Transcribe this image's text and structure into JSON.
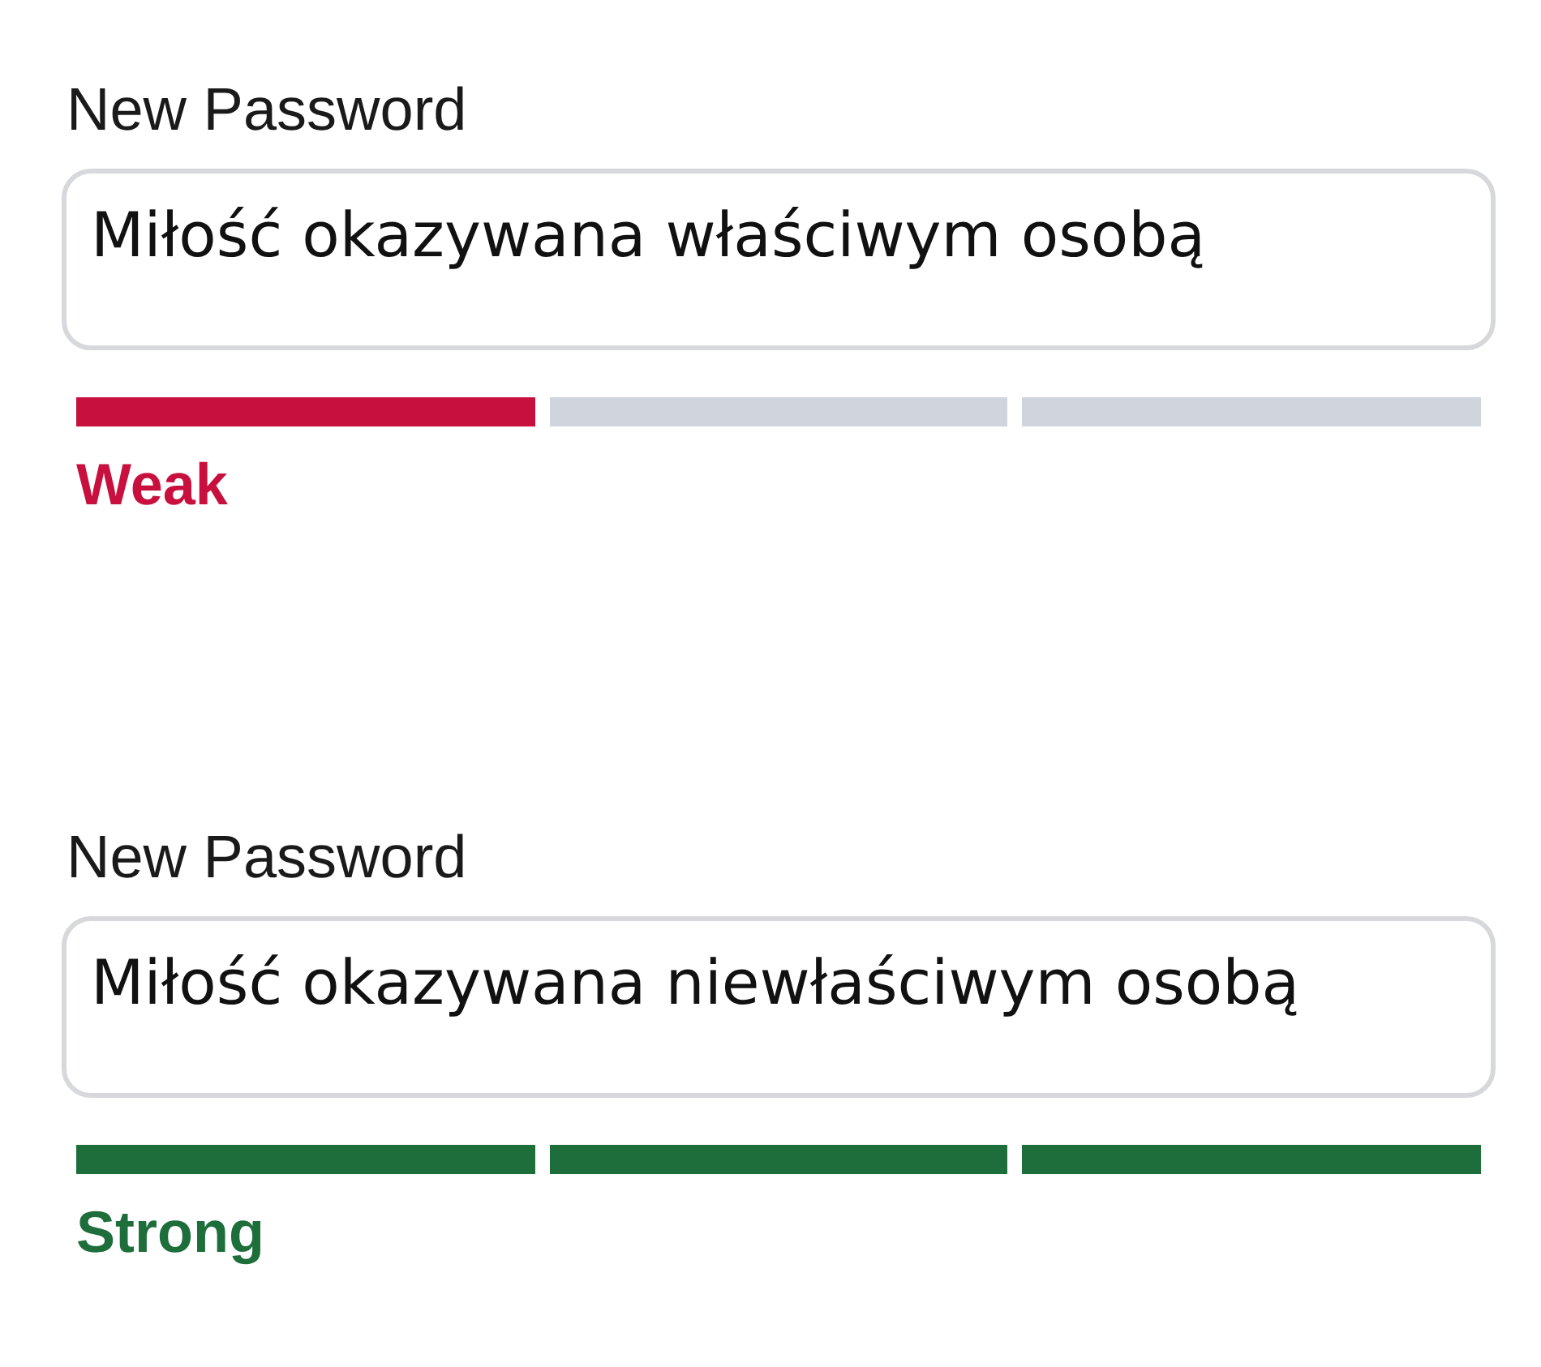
{
  "password_blocks": [
    {
      "label": "New Password",
      "value": "Miłość okazywana właściwym osobą",
      "kind": "weak",
      "strength_label": "Weak",
      "segments": [
        {
          "filled": true
        },
        {
          "filled": false
        },
        {
          "filled": false
        }
      ]
    },
    {
      "label": "New Password",
      "value": "Miłość okazywana niewłaściwym osobą",
      "kind": "strong",
      "strength_label": "Strong",
      "segments": [
        {
          "filled": true
        },
        {
          "filled": true
        },
        {
          "filled": true
        }
      ]
    }
  ]
}
